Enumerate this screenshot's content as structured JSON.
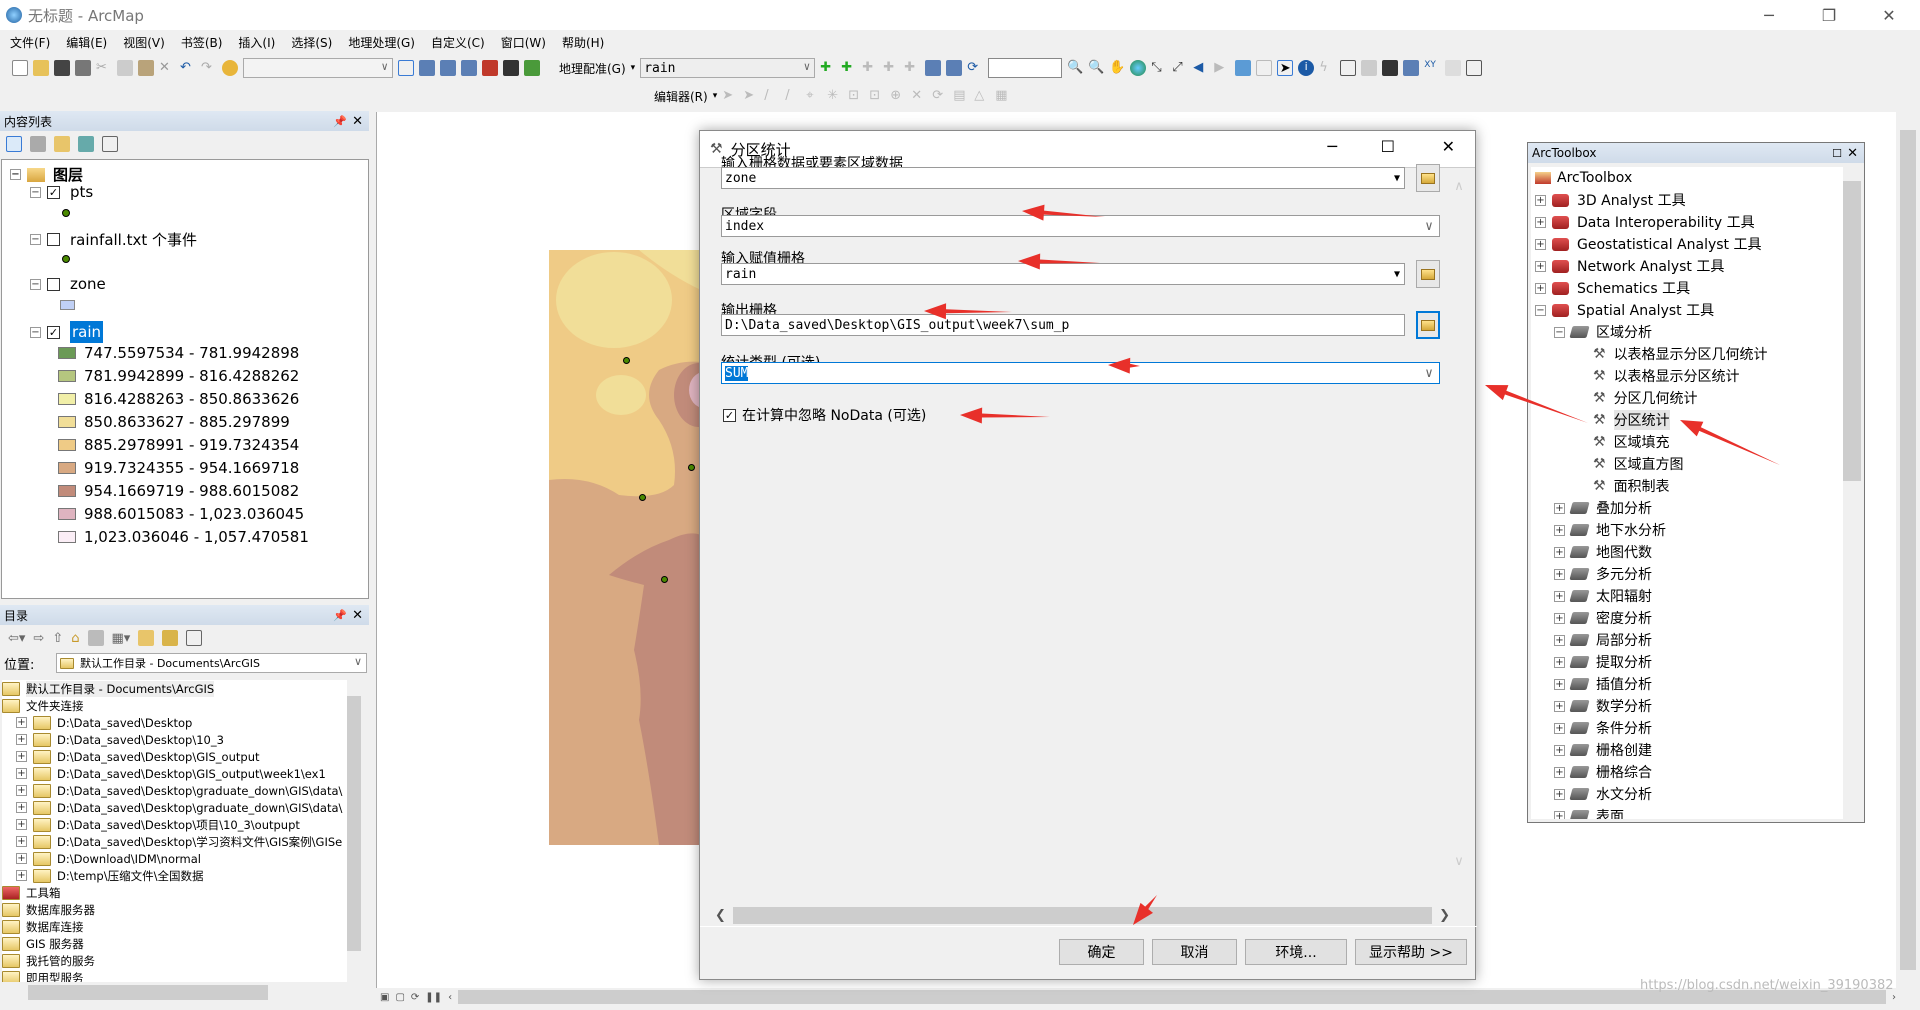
{
  "window": {
    "title": "无标题 - ArcMap",
    "minimize": "─",
    "restore": "❐",
    "close": "✕"
  },
  "menu": [
    "文件(F)",
    "编辑(E)",
    "视图(V)",
    "书签(B)",
    "插入(I)",
    "选择(S)",
    "地理处理(G)",
    "自定义(C)",
    "窗口(W)",
    "帮助(H)"
  ],
  "toolbar": {
    "georef_label": "地理配准(G)",
    "georef_layer": "rain",
    "editor_label": "编辑器(R)",
    "scale_value": ""
  },
  "toc": {
    "title": "内容列表",
    "root": "图层",
    "layers": [
      {
        "name": "pts",
        "checked": true
      },
      {
        "name": "rainfall.txt 个事件",
        "checked": false
      },
      {
        "name": "zone",
        "checked": false
      },
      {
        "name": "rain",
        "checked": true,
        "selected": true
      }
    ],
    "rain_classes": [
      {
        "label": "747.5597534 - 781.9942898",
        "color": "#6b9a56"
      },
      {
        "label": "781.9942899 - 816.4288262",
        "color": "#b5c67f"
      },
      {
        "label": "816.4288263 - 850.8633626",
        "color": "#f1efa8"
      },
      {
        "label": "850.8633627 - 885.297899",
        "color": "#f1de98"
      },
      {
        "label": "885.2978991 - 919.7324354",
        "color": "#efcb86"
      },
      {
        "label": "919.7324355 - 954.1669718",
        "color": "#d8a982"
      },
      {
        "label": "954.1669719 - 988.6015082",
        "color": "#c18b7a"
      },
      {
        "label": "988.6015083 - 1,023.036045",
        "color": "#dfb4c0"
      },
      {
        "label": "1,023.036046 - 1,057.470581",
        "color": "#fbeef6"
      }
    ]
  },
  "catalog": {
    "title": "目录",
    "location_label": "位置:",
    "location_value": "默认工作目录 - Documents\\ArcGIS",
    "items": [
      {
        "label": "默认工作目录 - Documents\\ArcGIS",
        "level": 0
      },
      {
        "label": "文件夹连接",
        "level": 0
      },
      {
        "label": "D:\\Data_saved\\Desktop",
        "level": 1
      },
      {
        "label": "D:\\Data_saved\\Desktop\\10_3",
        "level": 1
      },
      {
        "label": "D:\\Data_saved\\Desktop\\GIS_output",
        "level": 1
      },
      {
        "label": "D:\\Data_saved\\Desktop\\GIS_output\\week1\\ex1",
        "level": 1
      },
      {
        "label": "D:\\Data_saved\\Desktop\\graduate_down\\GIS\\data\\",
        "level": 1
      },
      {
        "label": "D:\\Data_saved\\Desktop\\graduate_down\\GIS\\data\\",
        "level": 1
      },
      {
        "label": "D:\\Data_saved\\Desktop\\项目\\10_3\\outpupt",
        "level": 1
      },
      {
        "label": "D:\\Data_saved\\Desktop\\学习资料文件\\GIS案例\\GISe",
        "level": 1
      },
      {
        "label": "D:\\Download\\IDM\\normal",
        "level": 1
      },
      {
        "label": "D:\\temp\\压缩文件\\全国数据",
        "level": 1
      },
      {
        "label": "工具箱",
        "level": 0
      },
      {
        "label": "数据库服务器",
        "level": 0
      },
      {
        "label": "数据库连接",
        "level": 0
      },
      {
        "label": "GIS 服务器",
        "level": 0
      },
      {
        "label": "我托管的服务",
        "level": 0
      },
      {
        "label": "即用型服务",
        "level": 0
      }
    ]
  },
  "dialog": {
    "title": "分区统计",
    "fields": [
      {
        "label": "输入栅格数据或要素区域数据",
        "value": "zone"
      },
      {
        "label": "区域字段",
        "value": "index"
      },
      {
        "label": "输入赋值栅格",
        "value": "rain"
      },
      {
        "label": "输出栅格",
        "value": "D:\\Data_saved\\Desktop\\GIS_output\\week7\\sum_p"
      },
      {
        "label": "统计类型 (可选)",
        "value": "SUM"
      }
    ],
    "ignore_nodata": {
      "label": "在计算中忽略 NoData (可选)",
      "checked": true
    },
    "buttons": {
      "ok": "确定",
      "cancel": "取消",
      "env": "环境...",
      "help": "显示帮助 >>"
    }
  },
  "toolbox": {
    "title": "ArcToolbox",
    "root": "ArcToolbox",
    "toolsets": [
      "3D Analyst 工具",
      "Data Interoperability 工具",
      "Geostatistical Analyst 工具",
      "Network Analyst 工具",
      "Schematics 工具",
      "Spatial Analyst 工具"
    ],
    "spatial_open": "区域分析",
    "zonal_tools": [
      "以表格显示分区几何统计",
      "以表格显示分区统计",
      "分区几何统计",
      "分区统计",
      "区域填充",
      "区域直方图",
      "面积制表"
    ],
    "selected_tool": "分区统计",
    "spatial_sets": [
      "叠加分析",
      "地下水分析",
      "地图代数",
      "多元分析",
      "太阳辐射",
      "密度分析",
      "局部分析",
      "提取分析",
      "插值分析",
      "数学分析",
      "条件分析",
      "栅格创建",
      "栅格综合",
      "水文分析",
      "表面"
    ]
  },
  "watermark": "https://blog.csdn.net/weixin_39190382",
  "colors": {
    "selection": "#0078d7",
    "annotation_arrow": "#e8302a"
  }
}
